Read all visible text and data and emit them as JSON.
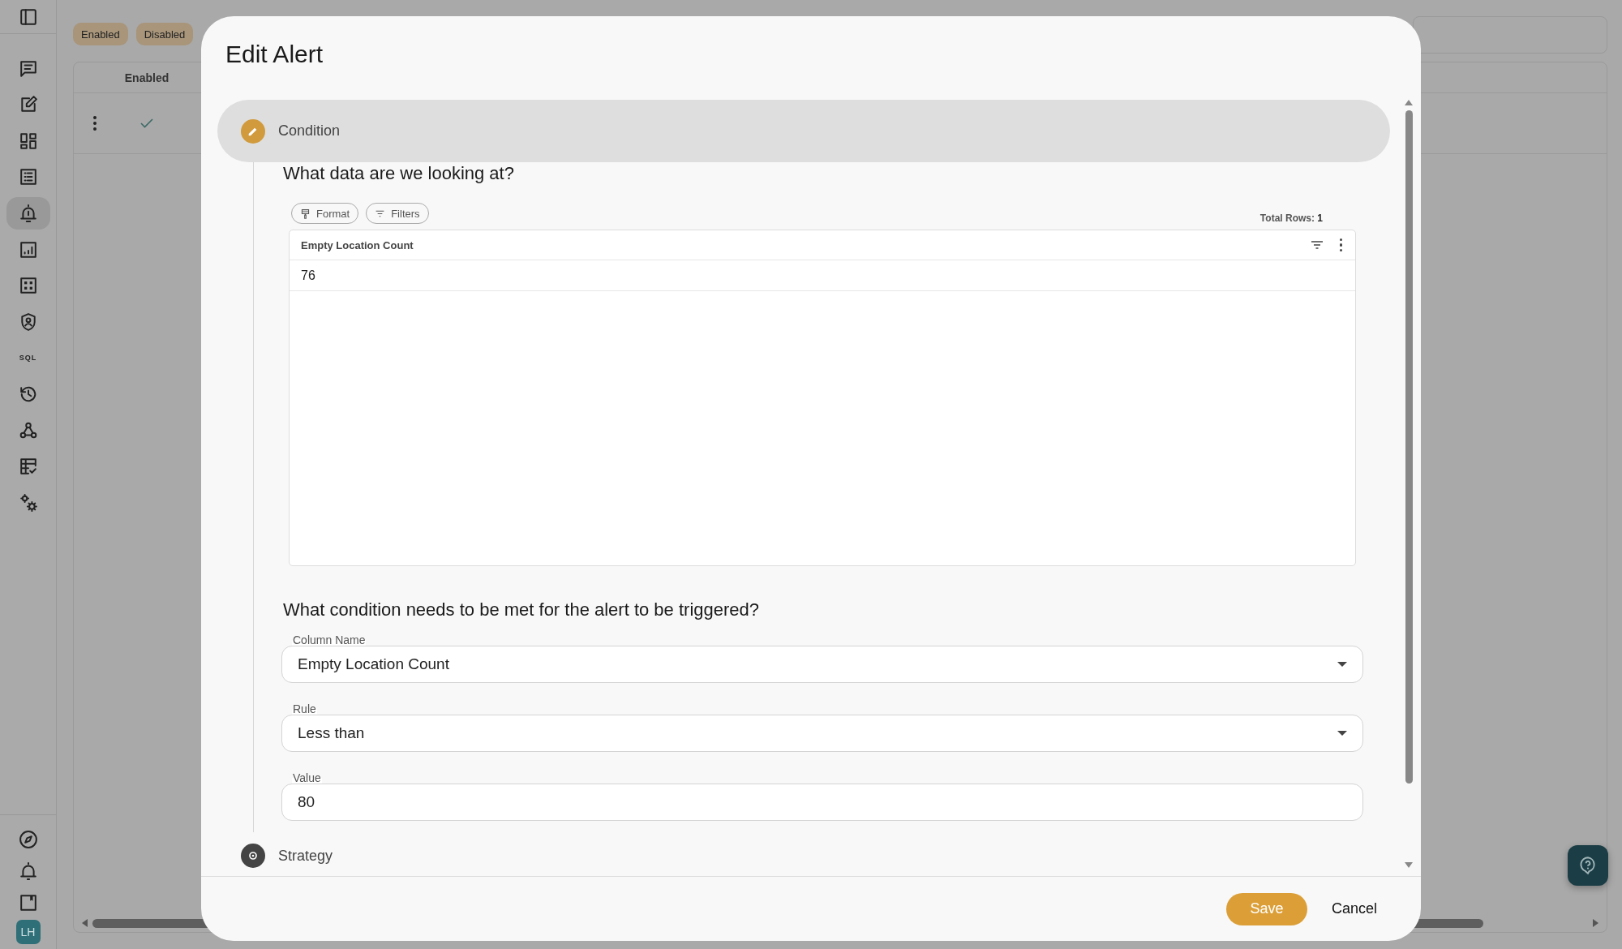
{
  "sidebar": {
    "items": [
      {
        "kind": "panel",
        "selected": false
      },
      {
        "kind": "chat",
        "selected": false
      },
      {
        "kind": "edit",
        "selected": false
      },
      {
        "kind": "dashboard",
        "selected": false
      },
      {
        "kind": "list",
        "selected": false
      },
      {
        "kind": "alert",
        "selected": true
      },
      {
        "kind": "report",
        "selected": false
      },
      {
        "kind": "grid",
        "selected": false
      },
      {
        "kind": "shield",
        "selected": false
      },
      {
        "kind": "sql",
        "label": "SQL",
        "selected": false
      },
      {
        "kind": "history",
        "selected": false
      },
      {
        "kind": "webhook",
        "selected": false
      },
      {
        "kind": "checklist",
        "selected": false
      },
      {
        "kind": "settings",
        "selected": false
      }
    ],
    "bottom_items": [
      {
        "kind": "compass"
      },
      {
        "kind": "bell"
      },
      {
        "kind": "book"
      }
    ],
    "avatar": "LH"
  },
  "background": {
    "filter_chips": [
      "Enabled",
      "Disabled"
    ],
    "table": {
      "columns": [
        "Enabled"
      ],
      "rows": [
        {
          "enabled": true
        }
      ]
    }
  },
  "modal": {
    "title": "Edit Alert",
    "steps": [
      {
        "label": "Condition",
        "kind": "edit",
        "selected": true
      },
      {
        "label": "Strategy",
        "kind": "settings",
        "selected": false
      }
    ],
    "data_section": {
      "question": "What data are we looking at?",
      "toolbar": [
        {
          "label": "Format",
          "kind": "format"
        },
        {
          "label": "Filters",
          "kind": "filters"
        }
      ],
      "total_rows_label": "Total Rows:",
      "total_rows": "1",
      "table": {
        "columns": [
          "Empty Location Count"
        ],
        "rows": [
          [
            "76"
          ]
        ]
      }
    },
    "condition_section": {
      "question": "What condition needs to be met for the alert to be triggered?",
      "fields": [
        {
          "label": "Column Name",
          "value": "Empty Location Count",
          "kind": "select"
        },
        {
          "label": "Rule",
          "value": "Less than",
          "kind": "select"
        },
        {
          "label": "Value",
          "value": "80",
          "kind": "input"
        }
      ]
    },
    "buttons": [
      {
        "label": "Save",
        "kind": "primary"
      },
      {
        "label": "Cancel",
        "kind": "text"
      }
    ]
  }
}
